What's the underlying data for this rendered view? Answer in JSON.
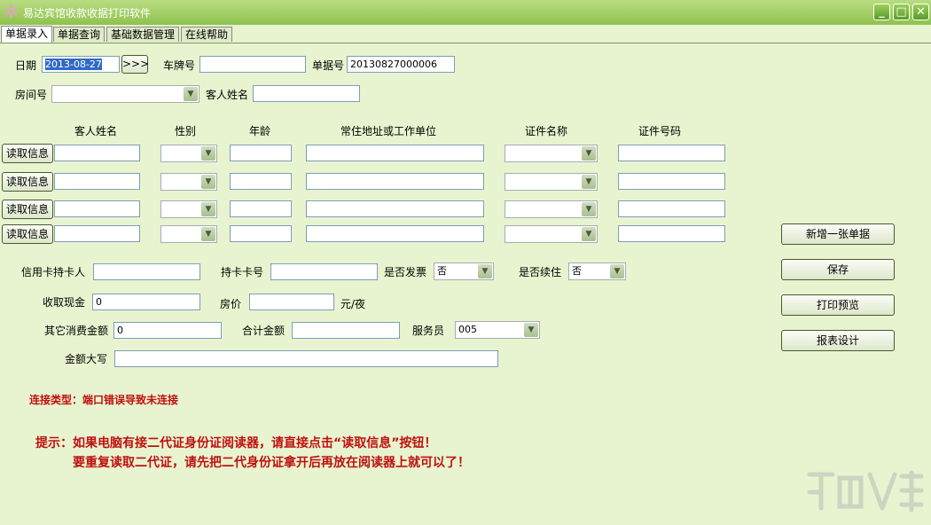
{
  "window": {
    "title": "易达宾馆收款收据打印软件",
    "min_label": "_",
    "max_label": "□",
    "close_label": "✕"
  },
  "tabs": [
    "单据录入",
    "单据查询",
    "基础数据管理",
    "在线帮助"
  ],
  "form": {
    "date_label": "日期",
    "date_value": "2013-08-27",
    "date_button": ">>>",
    "plate_label": "车牌号",
    "plate_value": "",
    "receipt_no_label": "单据号",
    "receipt_no_value": "20130827000006",
    "room_label": "房间号",
    "room_value": "",
    "guest_name_label": "客人姓名",
    "guest_name_value": ""
  },
  "guest_table": {
    "columns": [
      "客人姓名",
      "性别",
      "年龄",
      "常住地址或工作单位",
      "证件名称",
      "证件号码"
    ],
    "read_button": "读取信息",
    "rows": 4
  },
  "payment": {
    "card_holder_label": "信用卡持卡人",
    "card_holder_value": "",
    "card_no_label": "持卡卡号",
    "card_no_value": "",
    "invoice_label": "是否发票",
    "invoice_value": "否",
    "extend_label": "是否续住",
    "extend_value": "否",
    "cash_label": "收取现金",
    "cash_value": "0",
    "price_label": "房价",
    "price_value": "",
    "price_unit": "元/夜",
    "other_label": "其它消费金额",
    "other_value": "0",
    "total_label": "合计金额",
    "total_value": "",
    "staff_label": "服务员",
    "staff_value": "005",
    "uppercase_label": "金额大写",
    "uppercase_value": ""
  },
  "side_buttons": [
    "新增一张单据",
    "保存",
    "打印预览",
    "报表设计"
  ],
  "status": {
    "connection": "连接类型：端口错误导致未连接",
    "tip_line1": "提示：如果电脑有接二代证身份证阅读器，请直接点击“读取信息”按钮！",
    "tip_line2": "要重复读取二代证，请先把二代身份证拿开后再放在阅读器上就可以了！"
  },
  "colors": {
    "background": "#e7f4cf",
    "titlebar": "#8fc24f",
    "tip_text": "#c01010"
  }
}
